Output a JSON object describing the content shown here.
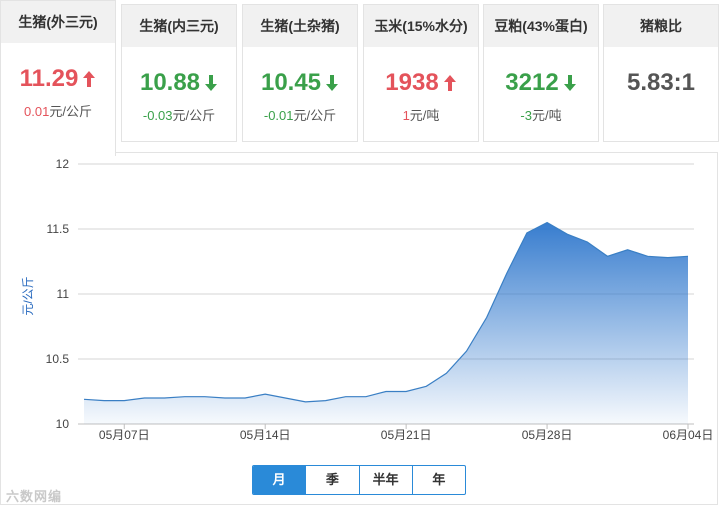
{
  "cards": [
    {
      "title": "生猪(外三元)",
      "value": "11.29",
      "direction": "up",
      "change": "0.01",
      "unit": "元/公斤",
      "active": true
    },
    {
      "title": "生猪(内三元)",
      "value": "10.88",
      "direction": "down",
      "change": "-0.03",
      "unit": "元/公斤",
      "active": false
    },
    {
      "title": "生猪(土杂猪)",
      "value": "10.45",
      "direction": "down",
      "change": "-0.01",
      "unit": "元/公斤",
      "active": false
    },
    {
      "title": "玉米(15%水分)",
      "value": "1938",
      "direction": "up",
      "change": "1",
      "unit": "元/吨",
      "active": false
    },
    {
      "title": "豆粕(43%蛋白)",
      "value": "3212",
      "direction": "down",
      "change": "-3",
      "unit": "元/吨",
      "active": false
    },
    {
      "title": "猪粮比",
      "value": "5.83:1",
      "direction": "flat",
      "change": "",
      "unit": "",
      "active": false
    }
  ],
  "colors": {
    "up": "#e4535b",
    "down": "#3aa04a",
    "accent": "#2a8ad8",
    "line": "#3a7fc4"
  },
  "range_tabs": [
    {
      "label": "月",
      "active": true
    },
    {
      "label": "季",
      "active": false
    },
    {
      "label": "半年",
      "active": false
    },
    {
      "label": "年",
      "active": false
    }
  ],
  "watermark": "六数网编",
  "chart_data": {
    "type": "area",
    "ylabel": "元/公斤",
    "ylim": [
      10,
      12
    ],
    "yticks": [
      10,
      10.5,
      11,
      11.5,
      12
    ],
    "xticks": [
      "05月07日",
      "05月14日",
      "05月21日",
      "05月28日",
      "06月04日"
    ],
    "grid": true,
    "series": [
      {
        "x": [
          "05/05",
          "05/06",
          "05/07",
          "05/08",
          "05/09",
          "05/10",
          "05/11",
          "05/12",
          "05/13",
          "05/14",
          "05/15",
          "05/16",
          "05/17",
          "05/18",
          "05/19",
          "05/20",
          "05/21",
          "05/22",
          "05/23",
          "05/24",
          "05/25",
          "05/26",
          "05/27",
          "05/28",
          "05/29",
          "05/30",
          "05/31",
          "06/01",
          "06/02",
          "06/03",
          "06/04"
        ],
        "values": [
          10.19,
          10.18,
          10.18,
          10.2,
          10.2,
          10.21,
          10.21,
          10.2,
          10.2,
          10.23,
          10.2,
          10.17,
          10.18,
          10.21,
          10.21,
          10.25,
          10.25,
          10.29,
          10.39,
          10.56,
          10.82,
          11.16,
          11.47,
          11.55,
          11.46,
          11.4,
          11.29,
          11.34,
          11.29,
          11.28,
          11.29
        ]
      }
    ]
  }
}
